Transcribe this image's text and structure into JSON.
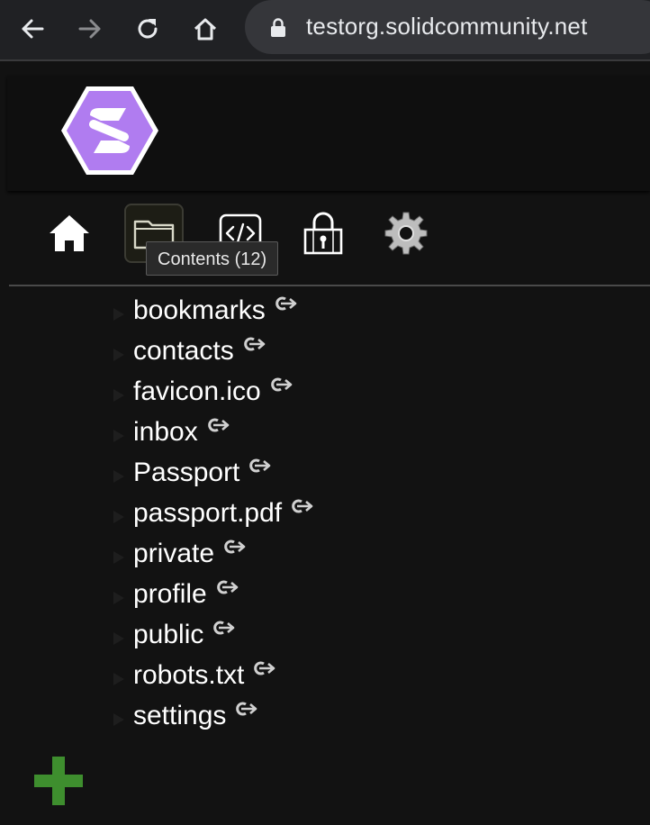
{
  "browser": {
    "url": "testorg.solidcommunity.net",
    "icons": [
      "back-arrow-icon",
      "forward-arrow-icon",
      "reload-icon",
      "home-icon",
      "lock-icon"
    ]
  },
  "tabs": [
    {
      "name": "home",
      "icon": "home-icon"
    },
    {
      "name": "contents",
      "icon": "folder-icon",
      "selected": true
    },
    {
      "name": "source",
      "icon": "code-icon"
    },
    {
      "name": "sharing",
      "icon": "padlock-icon"
    },
    {
      "name": "preferences",
      "icon": "gear-icon"
    }
  ],
  "tooltip": {
    "text": "Contents (12)"
  },
  "files": [
    {
      "name": "bookmarks"
    },
    {
      "name": "contacts"
    },
    {
      "name": "favicon.ico"
    },
    {
      "name": "inbox"
    },
    {
      "name": "Passport"
    },
    {
      "name": "passport.pdf"
    },
    {
      "name": "private"
    },
    {
      "name": "profile"
    },
    {
      "name": "public"
    },
    {
      "name": "robots.txt"
    },
    {
      "name": "settings"
    }
  ],
  "colors": {
    "background": "#121212",
    "logo_purple": "#b07cf0",
    "add_green": "#3e8e2e"
  }
}
